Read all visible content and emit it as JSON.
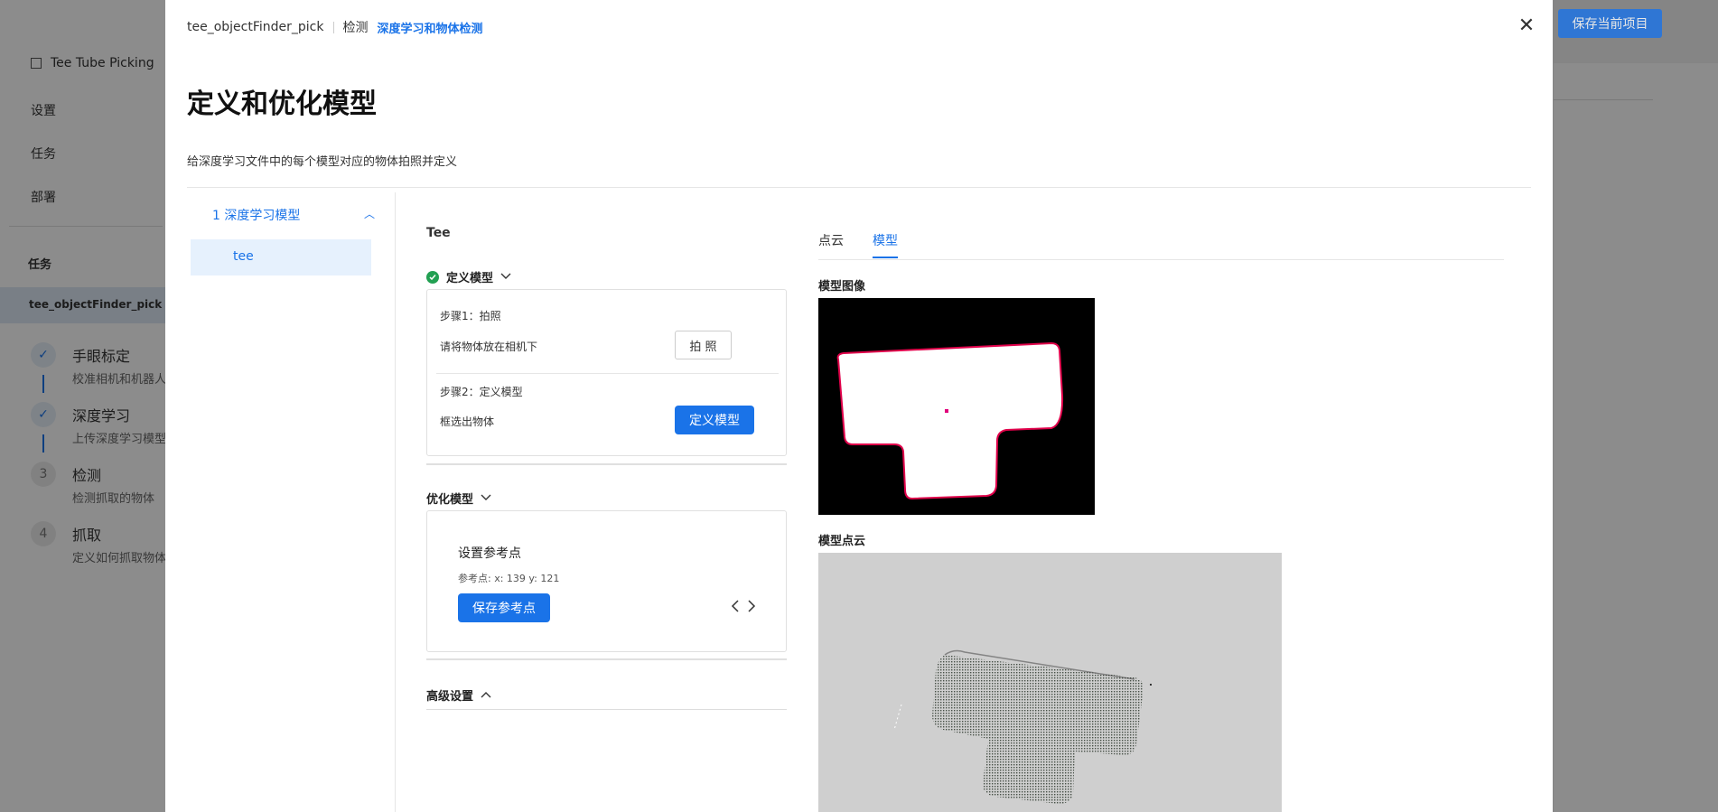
{
  "background": {
    "project_name": "Tee Tube Picking",
    "nav": [
      "设置",
      "任务",
      "部署"
    ],
    "section_label": "任务",
    "task_name": "tee_objectFinder_pick",
    "steps": [
      {
        "num": "1",
        "title": "手眼标定",
        "desc": "校准相机和机器人",
        "done": true
      },
      {
        "num": "2",
        "title": "深度学习",
        "desc": "上传深度学习模型",
        "done": true
      },
      {
        "num": "3",
        "title": "检测",
        "desc": "检测抓取的物体",
        "done": false
      },
      {
        "num": "4",
        "title": "抓取",
        "desc": "定义如何抓取物体",
        "done": false
      }
    ],
    "save_button": "保存当前项目"
  },
  "modal": {
    "breadcrumb": {
      "task": "tee_objectFinder_pick",
      "section": "检测",
      "current": "深度学习和物体检测"
    },
    "title": "定义和优化模型",
    "subtitle": "给深度学习文件中的每个模型对应的物体拍照并定义",
    "left_nav": {
      "group": "1 深度学习模型",
      "item": "tee"
    },
    "object_name": "Tee",
    "define_model": {
      "header": "定义模型",
      "step1_label": "步骤1：拍照",
      "step1_desc": "请将物体放在相机下",
      "photo_button": "拍 照",
      "step2_label": "步骤2：定义模型",
      "step2_desc": "框选出物体",
      "define_button": "定义模型"
    },
    "optimize_model": {
      "header": "优化模型",
      "ref_title": "设置参考点",
      "ref_point": "参考点: x: 139   y: 121",
      "save_ref_button": "保存参考点"
    },
    "advanced": {
      "header": "高级设置"
    },
    "tabs": [
      "点云",
      "模型"
    ],
    "active_tab": "模型",
    "model_image_label": "模型图像",
    "point_cloud_label": "模型点云"
  }
}
